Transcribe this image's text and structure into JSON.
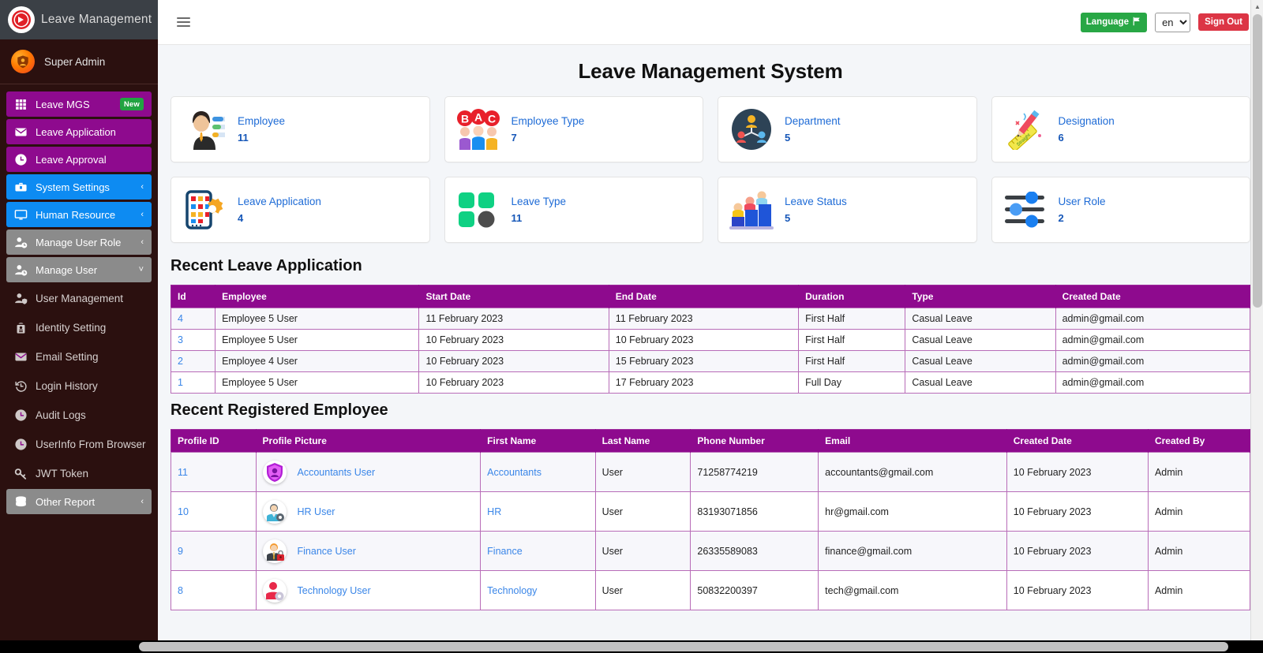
{
  "brand": {
    "title": "Leave Management",
    "logo_icon": "play-circle-icon"
  },
  "sidebar": {
    "user": {
      "name": "Super Admin",
      "avatar_icon": "user-shield-avatar-icon"
    },
    "items": [
      {
        "label": "Leave MGS",
        "icon": "grid-icon",
        "style": "purple",
        "badge": "New"
      },
      {
        "label": "Leave Application",
        "icon": "envelope-icon",
        "style": "purple"
      },
      {
        "label": "Leave Approval",
        "icon": "clock-icon",
        "style": "purple"
      },
      {
        "label": "System Settings",
        "icon": "toolbox-icon",
        "style": "blue",
        "caret": "‹"
      },
      {
        "label": "Human Resource",
        "icon": "desktop-icon",
        "style": "blue",
        "caret": "‹"
      },
      {
        "label": "Manage User Role",
        "icon": "user-clock-icon",
        "style": "gray",
        "caret": "‹"
      },
      {
        "label": "Manage User",
        "icon": "user-clock-icon",
        "style": "gray",
        "caret": "˅"
      },
      {
        "label": "User Management",
        "icon": "user-shield-icon",
        "style": "plain"
      },
      {
        "label": "Identity Setting",
        "icon": "fingerprint-id-icon",
        "style": "plain"
      },
      {
        "label": "Email Setting",
        "icon": "envelope-icon",
        "style": "plain"
      },
      {
        "label": "Login History",
        "icon": "history-icon",
        "style": "plain"
      },
      {
        "label": "Audit Logs",
        "icon": "clock-icon",
        "style": "plain"
      },
      {
        "label": "UserInfo From Browser",
        "icon": "clock-icon",
        "style": "plain"
      },
      {
        "label": "JWT Token",
        "icon": "key-icon",
        "style": "plain"
      },
      {
        "label": "Other Report",
        "icon": "database-icon",
        "style": "gray",
        "caret": "‹"
      }
    ]
  },
  "topbar": {
    "menu_toggle_icon": "hamburger-icon",
    "language_button": "Language",
    "language_flag_icon": "flag-icon",
    "language_selected": "en",
    "language_options": [
      "en"
    ],
    "sign_out": "Sign Out"
  },
  "page": {
    "title": "Leave Management System"
  },
  "cards": [
    {
      "label": "Employee",
      "count": "11",
      "icon": "employee-badge-icon"
    },
    {
      "label": "Employee Type",
      "count": "7",
      "icon": "employee-type-abc-icon"
    },
    {
      "label": "Department",
      "count": "5",
      "icon": "org-chart-icon"
    },
    {
      "label": "Designation",
      "count": "6",
      "icon": "ruler-pencil-icon"
    },
    {
      "label": "Leave Application",
      "count": "4",
      "icon": "mobile-gear-icon"
    },
    {
      "label": "Leave Type",
      "count": "11",
      "icon": "squares-grid-icon"
    },
    {
      "label": "Leave Status",
      "count": "5",
      "icon": "bar-people-icon"
    },
    {
      "label": "User Role",
      "count": "2",
      "icon": "sliders-icon"
    }
  ],
  "leave_applications": {
    "title": "Recent Leave Application",
    "columns": [
      "Id",
      "Employee",
      "Start Date",
      "End Date",
      "Duration",
      "Type",
      "Created Date"
    ],
    "rows": [
      {
        "id": "4",
        "employee": "Employee 5 User",
        "start": "11 February 2023",
        "end": "11 February 2023",
        "duration": "First Half",
        "type": "Casual Leave",
        "created": "admin@gmail.com"
      },
      {
        "id": "3",
        "employee": "Employee 5 User",
        "start": "10 February 2023",
        "end": "10 February 2023",
        "duration": "First Half",
        "type": "Casual Leave",
        "created": "admin@gmail.com"
      },
      {
        "id": "2",
        "employee": "Employee 4 User",
        "start": "10 February 2023",
        "end": "15 February 2023",
        "duration": "First Half",
        "type": "Casual Leave",
        "created": "admin@gmail.com"
      },
      {
        "id": "1",
        "employee": "Employee 5 User",
        "start": "10 February 2023",
        "end": "17 February 2023",
        "duration": "Full Day",
        "type": "Casual Leave",
        "created": "admin@gmail.com"
      }
    ]
  },
  "registered_employees": {
    "title": "Recent Registered Employee",
    "columns": [
      "Profile ID",
      "Profile Picture",
      "First Name",
      "Last Name",
      "Phone Number",
      "Email",
      "Created Date",
      "Created By"
    ],
    "rows": [
      {
        "profile_id": "11",
        "picture_name": "Accountants User",
        "picture_icon": "shield-user-purple-icon",
        "first_name": "Accountants",
        "last_name": "User",
        "phone": "71258774219",
        "email": "accountants@gmail.com",
        "created_date": "10 February 2023",
        "created_by": "Admin"
      },
      {
        "profile_id": "10",
        "picture_name": "HR User",
        "picture_icon": "user-gear-blue-icon",
        "first_name": "HR",
        "last_name": "User",
        "phone": "83193071856",
        "email": "hr@gmail.com",
        "created_date": "10 February 2023",
        "created_by": "Admin"
      },
      {
        "profile_id": "9",
        "picture_name": "Finance User",
        "picture_icon": "user-lock-icon",
        "first_name": "Finance",
        "last_name": "User",
        "phone": "26335589083",
        "email": "finance@gmail.com",
        "created_date": "10 February 2023",
        "created_by": "Admin"
      },
      {
        "profile_id": "8",
        "picture_name": "Technology User",
        "picture_icon": "user-cog-red-icon",
        "first_name": "Technology",
        "last_name": "User",
        "phone": "50832200397",
        "email": "tech@gmail.com",
        "created_date": "10 February 2023",
        "created_by": "Admin"
      }
    ]
  },
  "colors": {
    "sidebar_bg": "#2b100f",
    "brand_bg": "#3b4046",
    "accent_purple": "#8e0a8e",
    "accent_blue": "#0d8bf2",
    "accent_gray": "#8b8b8b",
    "link_blue": "#3a86e8",
    "success_green": "#28a745",
    "danger_red": "#dc3545"
  }
}
